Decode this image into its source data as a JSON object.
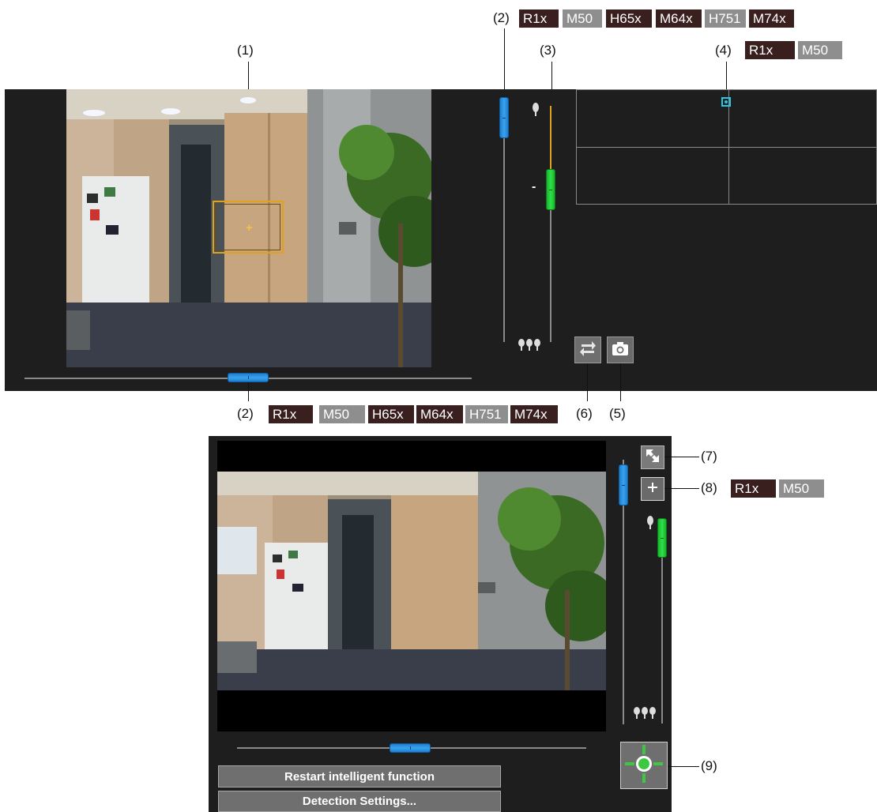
{
  "callouts": {
    "c1": "(1)",
    "c2_top": "(2)",
    "c3": "(3)",
    "c4": "(4)",
    "c2_bottom": "(2)",
    "c6": "(6)",
    "c5": "(5)",
    "c7": "(7)",
    "c8": "(8)",
    "c9": "(9)"
  },
  "model_tags": {
    "top_2": [
      {
        "label": "R1x",
        "style": "dark"
      },
      {
        "label": "M50",
        "style": "grey"
      },
      {
        "label": "H65x",
        "style": "dark"
      },
      {
        "label": "M64x",
        "style": "dark"
      },
      {
        "label": "H751",
        "style": "grey"
      },
      {
        "label": "M74x",
        "style": "dark"
      }
    ],
    "top_4": [
      {
        "label": "R1x",
        "style": "dark"
      },
      {
        "label": "M50",
        "style": "grey"
      }
    ],
    "bottom_2": [
      {
        "label": "R1x",
        "style": "dark"
      },
      {
        "label": "M50",
        "style": "grey"
      },
      {
        "label": "H65x",
        "style": "dark"
      },
      {
        "label": "M64x",
        "style": "dark"
      },
      {
        "label": "H751",
        "style": "grey"
      },
      {
        "label": "M74x",
        "style": "dark"
      }
    ],
    "eight": [
      {
        "label": "R1x",
        "style": "dark"
      },
      {
        "label": "M50",
        "style": "grey"
      }
    ]
  },
  "viewer_top": {
    "zoom_minus_label": "-",
    "pan_position": 0.5,
    "tilt_position": 0.05,
    "zoom_position": 0.27
  },
  "viewer_bottom": {
    "buttons": {
      "restart": "Restart intelligent function",
      "detection": "Detection Settings..."
    },
    "pan_position": 0.52,
    "tilt_position": 0.06,
    "zoom_position": 0.07
  },
  "icons": {
    "switch": "swap-arrows-icon",
    "snapshot": "camera-icon",
    "fullscreen": "fullscreen-icon",
    "add": "plus-icon",
    "preset": "crosshair-target-icon",
    "tele": "single-tree-icon",
    "wide": "three-trees-icon"
  },
  "colors": {
    "panel_bg": "#1e1e1e",
    "slider_blue": "#2a8fe0",
    "zoom_green": "#22cc3a",
    "region_orange": "#e0a21b",
    "tag_dark": "#3a1f1f",
    "tag_grey": "#8e8e8e",
    "button_grey": "#6f6f6f",
    "preset_green": "#3cc840"
  }
}
